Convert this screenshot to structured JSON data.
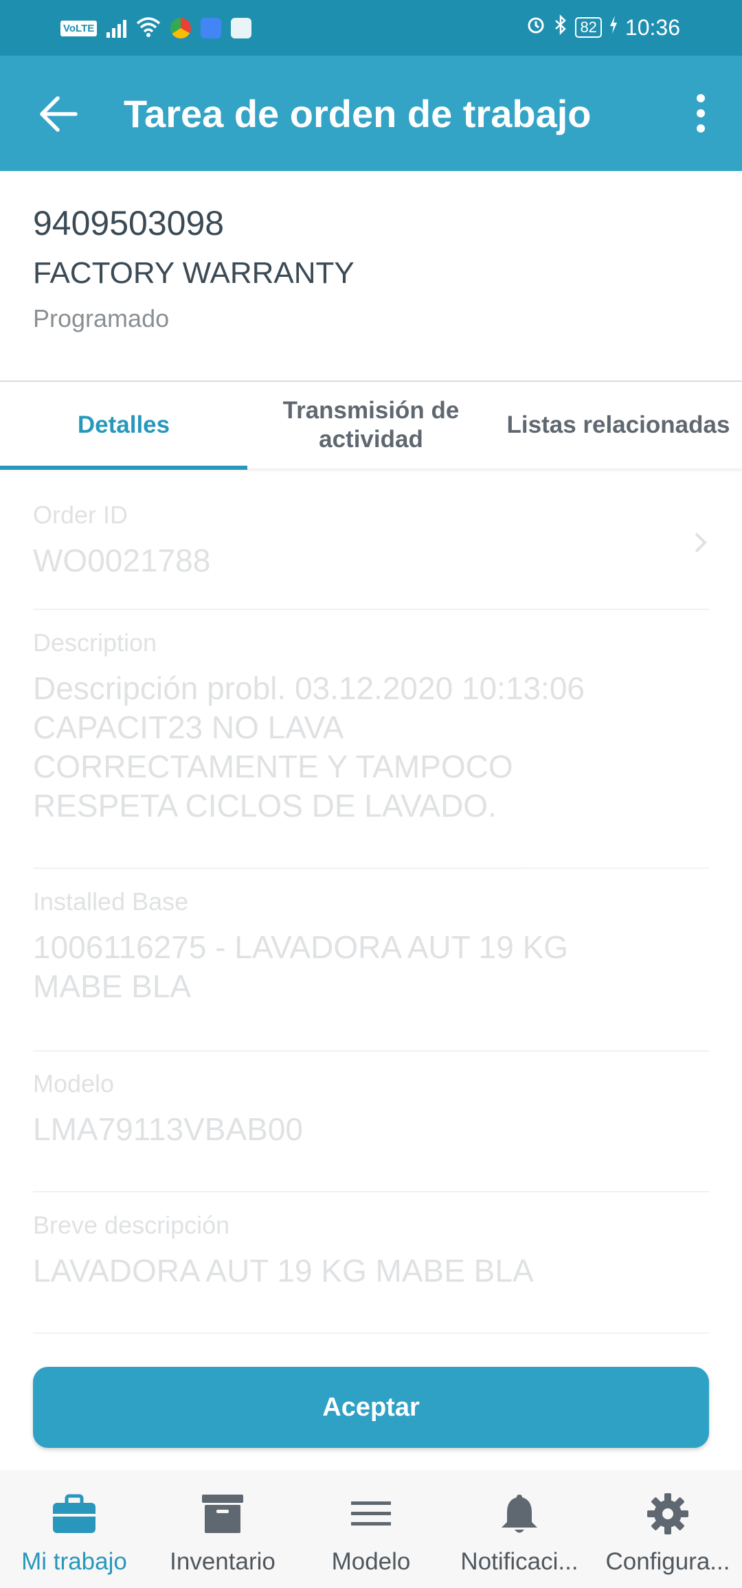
{
  "status_bar": {
    "volte": "VoLTE",
    "battery": "82",
    "time": "10:36"
  },
  "app_bar": {
    "title": "Tarea de orden de trabajo"
  },
  "header": {
    "number": "9409503098",
    "type": "FACTORY WARRANTY",
    "status": "Programado"
  },
  "tabs": [
    {
      "label": "Detalles",
      "active": true
    },
    {
      "label": "Transmisión de actividad",
      "active": false
    },
    {
      "label": "Listas relacionadas",
      "active": false
    }
  ],
  "fields": [
    {
      "label": "Order ID",
      "value": "WO0021788"
    },
    {
      "label": "Description",
      "value": "Descripción probl. 03.12.2020 10:13:06 CAPACIT23 NO LAVA CORRECTAMENTE Y TAMPOCO RESPETA CICLOS DE LAVADO."
    },
    {
      "label": "Installed Base",
      "value": "1006116275 - LAVADORA AUT 19 KG MABE BLA"
    },
    {
      "label": "Modelo",
      "value": "LMA79113VBAB00"
    },
    {
      "label": "Breve descripción",
      "value": "LAVADORA AUT 19 KG MABE BLA"
    }
  ],
  "accept_button": "Aceptar",
  "bottom_nav": [
    {
      "label": "Mi trabajo",
      "icon": "briefcase-icon",
      "active": true
    },
    {
      "label": "Inventario",
      "icon": "archive-box-icon",
      "active": false
    },
    {
      "label": "Modelo",
      "icon": "menu-lines-icon",
      "active": false
    },
    {
      "label": "Notificaci...",
      "icon": "bell-icon",
      "active": false
    },
    {
      "label": "Configura...",
      "icon": "gear-icon",
      "active": false
    }
  ],
  "colors": {
    "primary": "#33a3c6",
    "status_bar": "#1f8fb0",
    "accent": "#2897bb"
  }
}
